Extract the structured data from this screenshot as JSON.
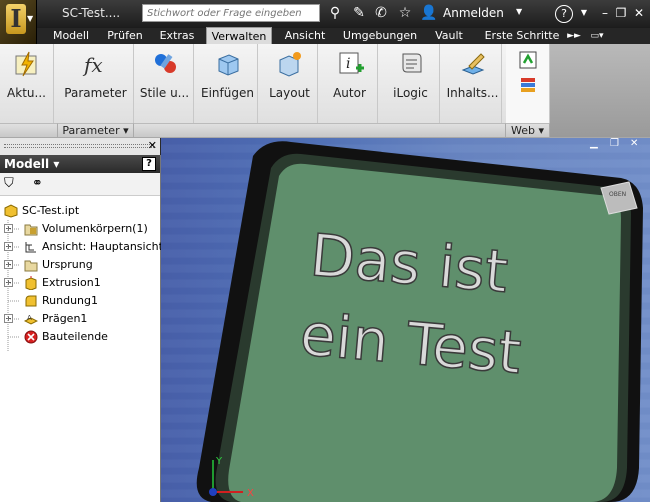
{
  "app": {
    "title": "SC-Test....",
    "search_placeholder": "Stichwort oder Frage eingeben",
    "signin_label": "Anmelden",
    "help_label": "?"
  },
  "tabs": [
    {
      "label": "Modell"
    },
    {
      "label": "Prüfen"
    },
    {
      "label": "Extras"
    },
    {
      "label": "Verwalten",
      "active": true
    },
    {
      "label": "Ansicht"
    },
    {
      "label": "Umgebungen"
    },
    {
      "label": "Vault"
    },
    {
      "label": "Erste Schritte"
    }
  ],
  "ribbon": {
    "buttons": [
      {
        "label": "Aktu..."
      },
      {
        "label": "Parameter"
      },
      {
        "label": "Stile u..."
      },
      {
        "label": "Einfügen"
      },
      {
        "label": "Layout"
      },
      {
        "label": "Autor"
      },
      {
        "label": "iLogic"
      },
      {
        "label": "Inhalts..."
      }
    ],
    "groups": [
      {
        "label": "Parameter"
      },
      {
        "label": "Web"
      }
    ]
  },
  "browser": {
    "title": "Modell",
    "help": "?",
    "nodes": [
      {
        "label": "SC-Test.ipt"
      },
      {
        "label": "Volumenkörpern(1)"
      },
      {
        "label": "Ansicht: Hauptansicht"
      },
      {
        "label": "Ursprung"
      },
      {
        "label": "Extrusion1"
      },
      {
        "label": "Rundung1"
      },
      {
        "label": "Prägen1"
      },
      {
        "label": "Bauteilende"
      }
    ]
  },
  "viewport": {
    "text_line1": "Das ist",
    "text_line2": "ein Test",
    "viewcube_label": "OBEN",
    "axis_x": "X",
    "axis_y": "Y"
  },
  "colors": {
    "plate": "#5f8f6c",
    "plate_frame": "#111111",
    "viewport_bg": "#5572b8"
  }
}
